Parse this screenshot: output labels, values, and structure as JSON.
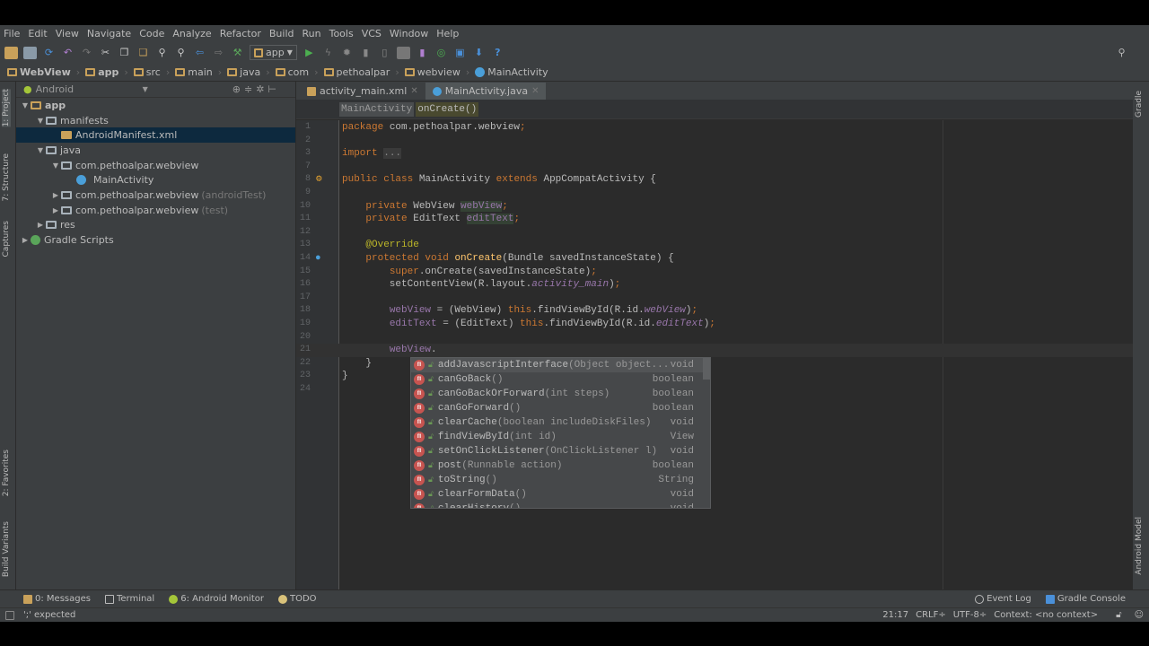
{
  "menu": [
    "File",
    "Edit",
    "View",
    "Navigate",
    "Code",
    "Analyze",
    "Refactor",
    "Build",
    "Run",
    "Tools",
    "VCS",
    "Window",
    "Help"
  ],
  "toolbar": {
    "run_config": "app",
    "help": "?"
  },
  "breadcrumbs": [
    "WebView",
    "app",
    "src",
    "main",
    "java",
    "com",
    "pethoalpar",
    "webview",
    "MainActivity"
  ],
  "left_strip": [
    "1: Project",
    "7: Structure",
    "Captures",
    "2: Favorites",
    "Build Variants"
  ],
  "right_strip": [
    "Gradle",
    "Android Model"
  ],
  "project": {
    "view": "Android",
    "tree": [
      {
        "label": "app",
        "depth": 0,
        "arrow": "▼"
      },
      {
        "label": "manifests",
        "depth": 1,
        "arrow": "▼"
      },
      {
        "label": "AndroidManifest.xml",
        "depth": 2,
        "arrow": "",
        "selected": true
      },
      {
        "label": "java",
        "depth": 1,
        "arrow": "▼"
      },
      {
        "label": "com.pethoalpar.webview",
        "depth": 2,
        "arrow": "▼"
      },
      {
        "label": "MainActivity",
        "depth": 3,
        "arrow": ""
      },
      {
        "label": "com.pethoalpar.webview",
        "suffix": "(androidTest)",
        "depth": 2,
        "arrow": "▶"
      },
      {
        "label": "com.pethoalpar.webview",
        "suffix": "(test)",
        "depth": 2,
        "arrow": "▶"
      },
      {
        "label": "res",
        "depth": 1,
        "arrow": "▶"
      },
      {
        "label": "Gradle Scripts",
        "depth": 0,
        "arrow": "▶"
      }
    ]
  },
  "tabs": [
    {
      "label": "activity_main.xml",
      "active": false
    },
    {
      "label": "MainActivity.java",
      "active": true
    }
  ],
  "nav": {
    "class": "MainActivity",
    "method": "onCreate()"
  },
  "code": [
    {
      "n": "1",
      "t": [
        [
          "kw",
          "package "
        ],
        [
          "",
          "com.pethoalpar.webview"
        ],
        [
          "kw",
          ";"
        ]
      ]
    },
    {
      "n": "2",
      "t": []
    },
    {
      "n": "3",
      "t": [
        [
          "kw",
          "import "
        ],
        [
          "fold2",
          "..."
        ]
      ]
    },
    {
      "n": "7",
      "t": []
    },
    {
      "n": "8",
      "t": [
        [
          "kw",
          "public class "
        ],
        [
          "",
          "MainActivity "
        ],
        [
          "kw",
          "extends "
        ],
        [
          "",
          "AppCompatActivity {"
        ]
      ]
    },
    {
      "n": "9",
      "t": []
    },
    {
      "n": "10",
      "t": [
        [
          "",
          "    "
        ],
        [
          "kw",
          "private "
        ],
        [
          "",
          "WebView "
        ],
        [
          "fld hl",
          "webView"
        ],
        [
          "kw",
          ";"
        ]
      ]
    },
    {
      "n": "11",
      "t": [
        [
          "",
          "    "
        ],
        [
          "kw",
          "private "
        ],
        [
          "",
          "EditText "
        ],
        [
          "fld hl",
          "editText"
        ],
        [
          "kw",
          ";"
        ]
      ]
    },
    {
      "n": "12",
      "t": []
    },
    {
      "n": "13",
      "t": [
        [
          "",
          "    "
        ],
        [
          "ann",
          "@Override"
        ]
      ]
    },
    {
      "n": "14",
      "t": [
        [
          "",
          "    "
        ],
        [
          "kw",
          "protected void "
        ],
        [
          "fn",
          "onCreate"
        ],
        [
          "",
          "(Bundle savedInstanceState) {"
        ]
      ]
    },
    {
      "n": "15",
      "t": [
        [
          "",
          "        "
        ],
        [
          "kw",
          "super"
        ],
        [
          "",
          ".onCreate(savedInstanceState)"
        ],
        [
          "kw",
          ";"
        ]
      ]
    },
    {
      "n": "16",
      "t": [
        [
          "",
          "        setContentView(R.layout."
        ],
        [
          "it",
          "activity_main"
        ],
        [
          "",
          ")"
        ],
        [
          "kw",
          ";"
        ]
      ]
    },
    {
      "n": "17",
      "t": []
    },
    {
      "n": "18",
      "t": [
        [
          "",
          "        "
        ],
        [
          "fld",
          "webView"
        ],
        [
          "",
          " = (WebView) "
        ],
        [
          "kw",
          "this"
        ],
        [
          "",
          ".findViewById(R.id."
        ],
        [
          "it",
          "webView"
        ],
        [
          "",
          ")"
        ],
        [
          "kw",
          ";"
        ]
      ]
    },
    {
      "n": "19",
      "t": [
        [
          "",
          "        "
        ],
        [
          "fld",
          "editText"
        ],
        [
          "",
          " = (EditText) "
        ],
        [
          "kw",
          "this"
        ],
        [
          "",
          ".findViewById(R.id."
        ],
        [
          "it",
          "editText"
        ],
        [
          "",
          ")"
        ],
        [
          "kw",
          ";"
        ]
      ]
    },
    {
      "n": "20",
      "t": []
    },
    {
      "n": "21",
      "t": [
        [
          "",
          "        "
        ],
        [
          "fld",
          "webView"
        ],
        [
          "",
          "."
        ]
      ],
      "current": true
    },
    {
      "n": "22",
      "t": [
        [
          "",
          "    }"
        ]
      ]
    },
    {
      "n": "23",
      "t": [
        [
          "",
          "}"
        ]
      ]
    },
    {
      "n": "24",
      "t": []
    }
  ],
  "completion": [
    {
      "name": "addJavascriptInterface",
      "params": "(Object object...",
      "ret": "void"
    },
    {
      "name": "canGoBack",
      "params": "()",
      "ret": "boolean"
    },
    {
      "name": "canGoBackOrForward",
      "params": "(int steps)",
      "ret": "boolean"
    },
    {
      "name": "canGoForward",
      "params": "()",
      "ret": "boolean"
    },
    {
      "name": "clearCache",
      "params": "(boolean includeDiskFiles)",
      "ret": "void"
    },
    {
      "name": "findViewById",
      "params": "(int id)",
      "ret": "View"
    },
    {
      "name": "setOnClickListener",
      "params": "(OnClickListener l)",
      "ret": "void"
    },
    {
      "name": "post",
      "params": "(Runnable action)",
      "ret": "boolean"
    },
    {
      "name": "toString",
      "params": "()",
      "ret": "String"
    },
    {
      "name": "clearFormData",
      "params": "()",
      "ret": "void"
    },
    {
      "name": "clearHistory",
      "params": "()",
      "ret": "void"
    }
  ],
  "bottom_tools": {
    "messages": "0: Messages",
    "terminal": "Terminal",
    "monitor": "6: Android Monitor",
    "todo": "TODO",
    "event_log": "Event Log",
    "gradle_console": "Gradle Console"
  },
  "status": {
    "message": "';' expected",
    "position": "21:17",
    "line_sep": "CRLF÷",
    "encoding": "UTF-8÷",
    "context": "Context: <no context>"
  }
}
